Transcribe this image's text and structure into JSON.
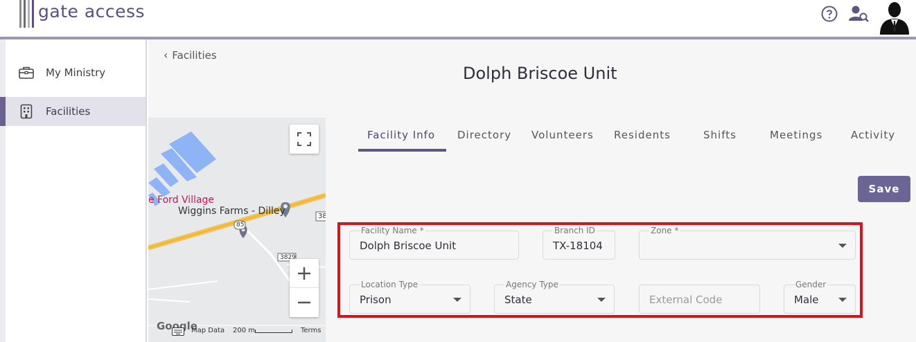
{
  "app": {
    "logo_text": "gate access"
  },
  "sidebar": {
    "items": [
      {
        "label": "My Ministry",
        "icon": "briefcase-icon"
      },
      {
        "label": "Facilities",
        "icon": "building-icon"
      }
    ]
  },
  "header": {
    "back_label": "Facilities",
    "title": "Dolph Briscoe Unit"
  },
  "tabs": [
    {
      "label": "Facility Info",
      "active": true
    },
    {
      "label": "Directory"
    },
    {
      "label": "Volunteers"
    },
    {
      "label": "Residents"
    },
    {
      "label": "Shifts"
    },
    {
      "label": "Meetings"
    },
    {
      "label": "Activity"
    }
  ],
  "actions": {
    "save_label": "Save"
  },
  "form": {
    "facility_name": {
      "label": "Facility Name *",
      "value": "Dolph Briscoe Unit"
    },
    "branch_id": {
      "label": "Branch ID",
      "value": "TX-18104"
    },
    "zone": {
      "label": "Zone *",
      "value": ""
    },
    "location_type": {
      "label": "Location Type",
      "value": "Prison"
    },
    "agency_type": {
      "label": "Agency Type",
      "value": "State"
    },
    "external_code": {
      "placeholder": "External Code",
      "value": ""
    },
    "gender": {
      "label": "Gender",
      "value": "Male"
    }
  },
  "map": {
    "labels": {
      "village": "e Ford Village",
      "farms": "Wiggins Farms - Dilley",
      "route_85": "85",
      "route_3829": "3829",
      "route_edge": "38",
      "attribution": "Map Data",
      "scale": "200 m",
      "terms": "Terms",
      "google": "Google"
    },
    "colors": {
      "road": "#f4c04e",
      "building": "#8fb4f5",
      "village": "#c2185b",
      "pin": "#6f6f8e"
    }
  },
  "colors": {
    "accent": "#6a6595",
    "highlight_frame": "#d7141a",
    "topbar_line": "#9d97b3"
  }
}
